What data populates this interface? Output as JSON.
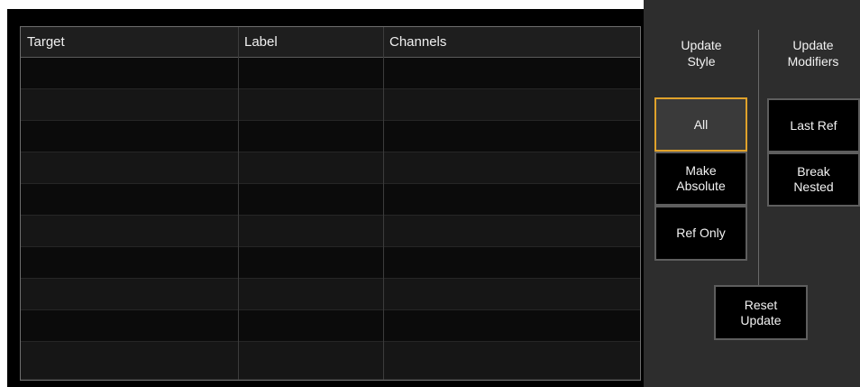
{
  "table": {
    "columns": [
      "Target",
      "Label",
      "Channels"
    ],
    "rows": [
      [
        "",
        "",
        ""
      ],
      [
        "",
        "",
        ""
      ],
      [
        "",
        "",
        ""
      ],
      [
        "",
        "",
        ""
      ],
      [
        "",
        "",
        ""
      ],
      [
        "",
        "",
        ""
      ],
      [
        "",
        "",
        ""
      ],
      [
        "",
        "",
        ""
      ],
      [
        "",
        "",
        ""
      ],
      [
        "",
        "",
        ""
      ]
    ]
  },
  "update_style": {
    "heading": "Update\nStyle",
    "buttons": [
      {
        "label": "All",
        "selected": true
      },
      {
        "label": "Make\nAbsolute",
        "selected": false
      },
      {
        "label": "Ref Only",
        "selected": false
      }
    ]
  },
  "update_modifiers": {
    "heading": "Update\nModifiers",
    "buttons": [
      {
        "label": "Last Ref",
        "selected": false
      },
      {
        "label": "Break\nNested",
        "selected": false
      }
    ]
  },
  "reset_update": {
    "label": "Reset\nUpdate"
  },
  "colors": {
    "accent": "#e0a22b",
    "background": "#000000",
    "panel": "#2d2d2d"
  }
}
